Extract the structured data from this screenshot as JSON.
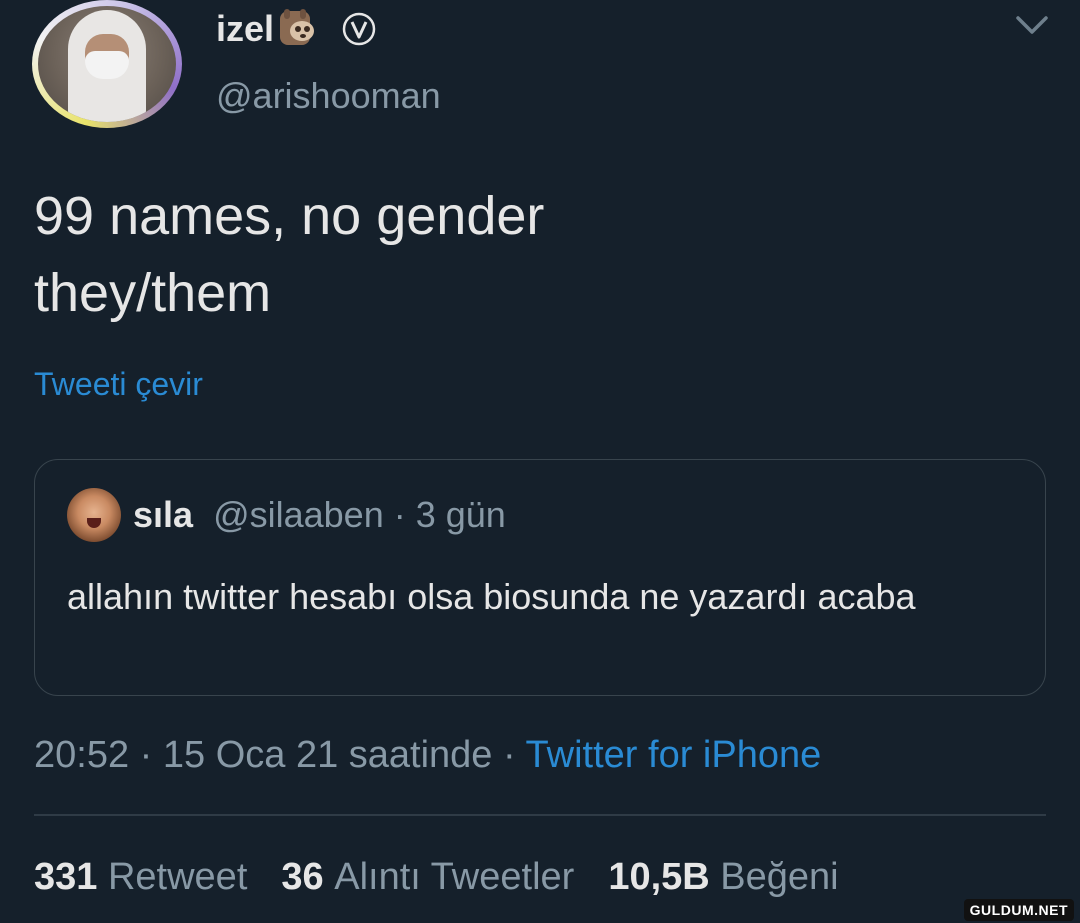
{
  "author": {
    "display_name": "izel",
    "handle": "@arishooman",
    "emoji_icon": "sloth-icon",
    "badge_icon": "verified-icon"
  },
  "tweet": {
    "lines": [
      "99 names, no gender",
      "they/them"
    ],
    "translate_label": "Tweeti çevir"
  },
  "quote": {
    "name": "sıla",
    "handle": "@silaaben",
    "separator": " · ",
    "age": "3 gün",
    "text": "allahın twitter hesabı olsa biosunda ne yazardı acaba"
  },
  "meta": {
    "time": "20:52",
    "date_text": "15 Oca 21 saatinde",
    "separator": " · ",
    "source": "Twitter for iPhone"
  },
  "stats": [
    {
      "count": "331",
      "label": "Retweet"
    },
    {
      "count": "36",
      "label": "Alıntı Tweetler"
    },
    {
      "count": "10,5B",
      "label": "Beğeni"
    }
  ],
  "watermark": "GULDUM.NET",
  "colors": {
    "background": "#15202b",
    "link": "#2a8bd4",
    "secondary_text": "#8899a6"
  }
}
